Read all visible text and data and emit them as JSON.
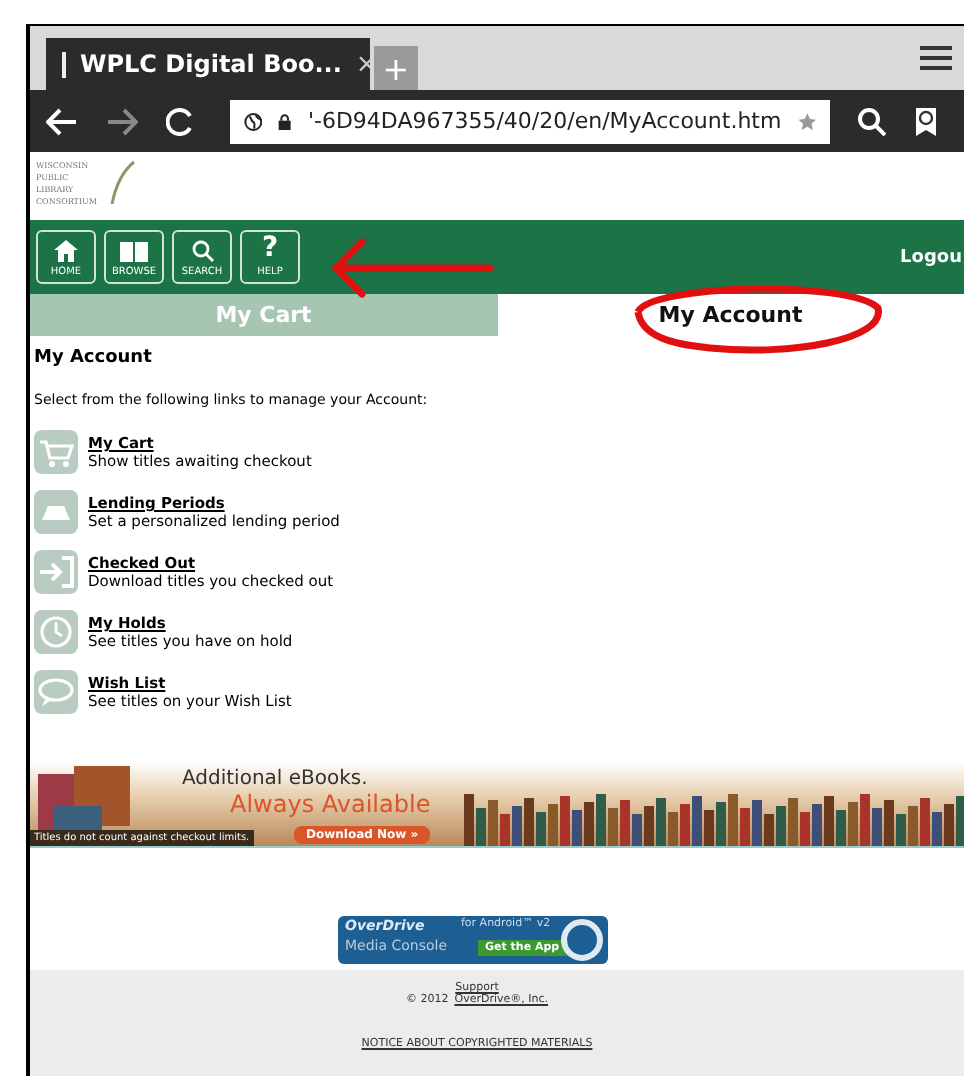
{
  "browser": {
    "tab_title": "WPLC Digital Boo...",
    "tab_close": "×",
    "new_tab": "+",
    "url": "'-6D94DA967355/40/20/en/MyAccount.htm"
  },
  "logo": {
    "lines": [
      "WISCONSIN",
      "PUBLIC",
      "LIBRARY",
      "CONSORTIUM"
    ]
  },
  "nav": {
    "buttons": [
      {
        "kind": "home",
        "label": "HOME"
      },
      {
        "kind": "browse",
        "label": "BROWSE"
      },
      {
        "kind": "search",
        "label": "SEARCH"
      },
      {
        "kind": "help",
        "label": "HELP",
        "glyph": "?"
      }
    ],
    "logout": "Logou"
  },
  "tabs": [
    {
      "label": "My Cart",
      "selected": false
    },
    {
      "label": "My Account",
      "selected": true
    }
  ],
  "heading": "My Account",
  "intro": "Select from the following links to manage your Account:",
  "links": [
    {
      "kind": "cart",
      "title": "My Cart",
      "description": "Show titles awaiting checkout"
    },
    {
      "kind": "lending",
      "title": "Lending Periods",
      "description": "Set a personalized lending period"
    },
    {
      "kind": "checkout",
      "title": "Checked Out",
      "description": "Download titles you checked out"
    },
    {
      "kind": "holds",
      "title": "My Holds",
      "description": "See titles you have on hold"
    },
    {
      "kind": "wish",
      "title": "Wish List",
      "description": "See titles on your Wish List"
    }
  ],
  "banner": {
    "line_1": "Additional eBooks.",
    "line_2": "Always Available",
    "note": "Titles do not count against checkout limits.",
    "button": "Download Now »"
  },
  "app_badge": {
    "brand": "OverDrive",
    "product": "Media Console",
    "platform": "for Android™ v2",
    "button": "Get the App"
  },
  "footer": {
    "support": "Support",
    "copyright": "© 2012",
    "company": "OverDrive®, Inc.",
    "notice": "NOTICE ABOUT COPYRIGHTED MATERIALS"
  }
}
